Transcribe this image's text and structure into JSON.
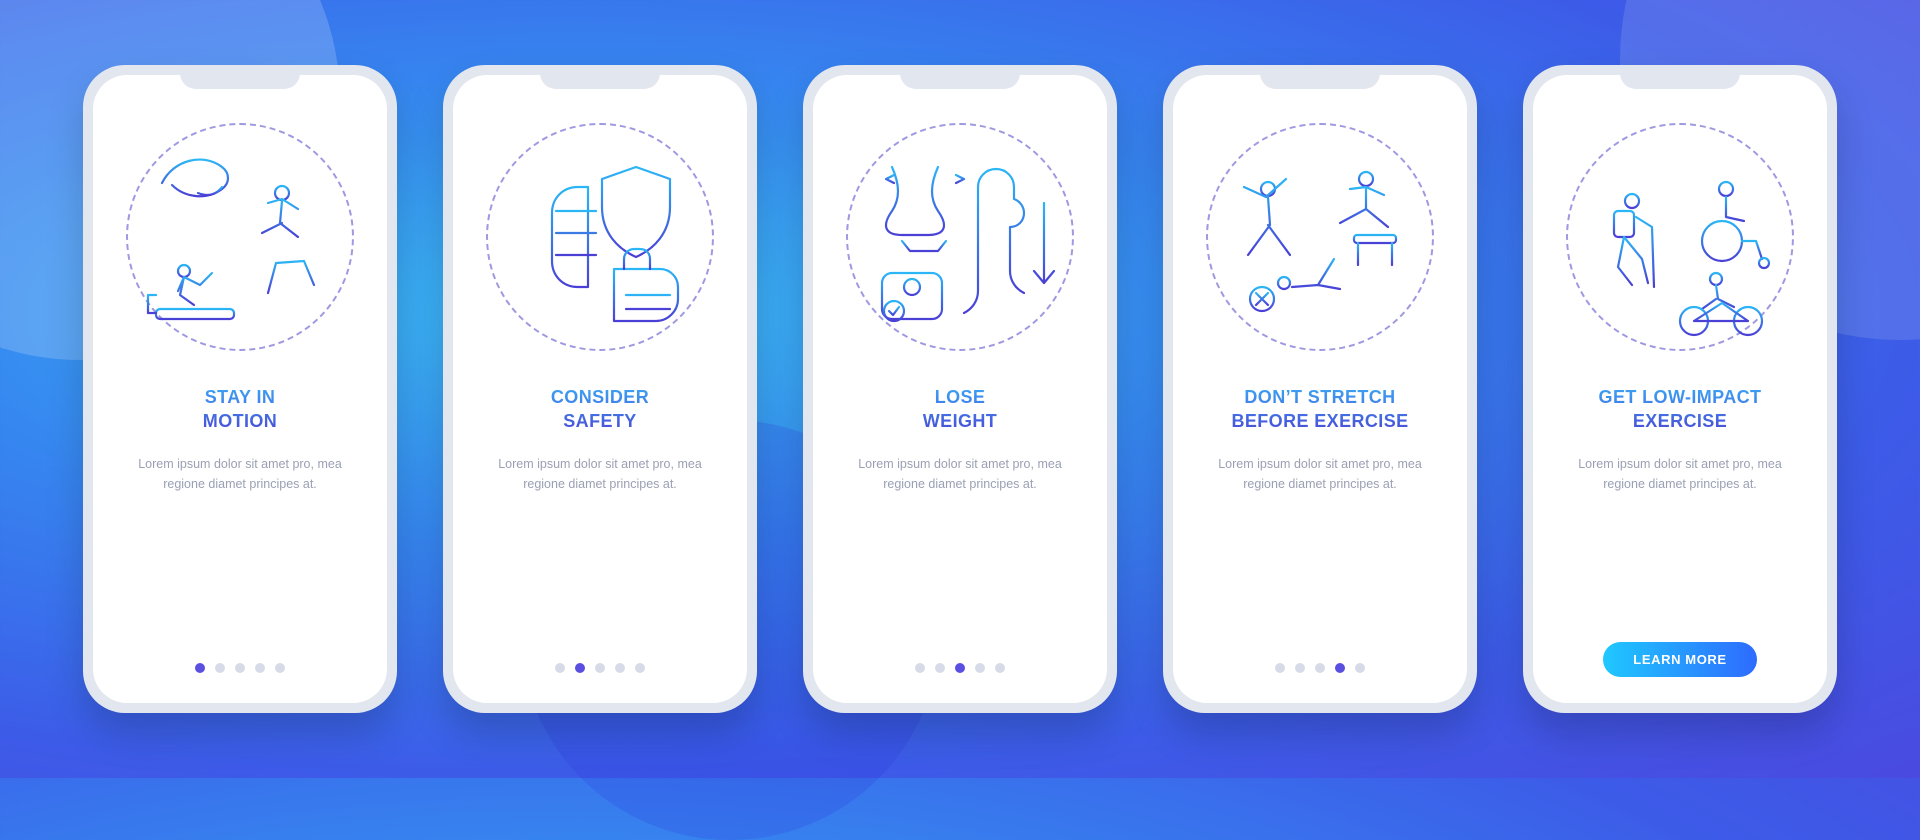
{
  "lorem": "Lorem ipsum dolor sit amet pro, mea regione diamet principes at.",
  "cta_label": "LEARN MORE",
  "screens": [
    {
      "title": "STAY IN\nMOTION",
      "active_dot": 0,
      "has_cta": false
    },
    {
      "title": "CONSIDER\nSAFETY",
      "active_dot": 1,
      "has_cta": false
    },
    {
      "title": "LOSE\nWEIGHT",
      "active_dot": 2,
      "has_cta": false
    },
    {
      "title": "DON’T STRETCH\nBEFORE EXERCISE",
      "active_dot": 3,
      "has_cta": false
    },
    {
      "title": "GET LOW-IMPACT\nEXERCISE",
      "active_dot": 4,
      "has_cta": true
    }
  ]
}
